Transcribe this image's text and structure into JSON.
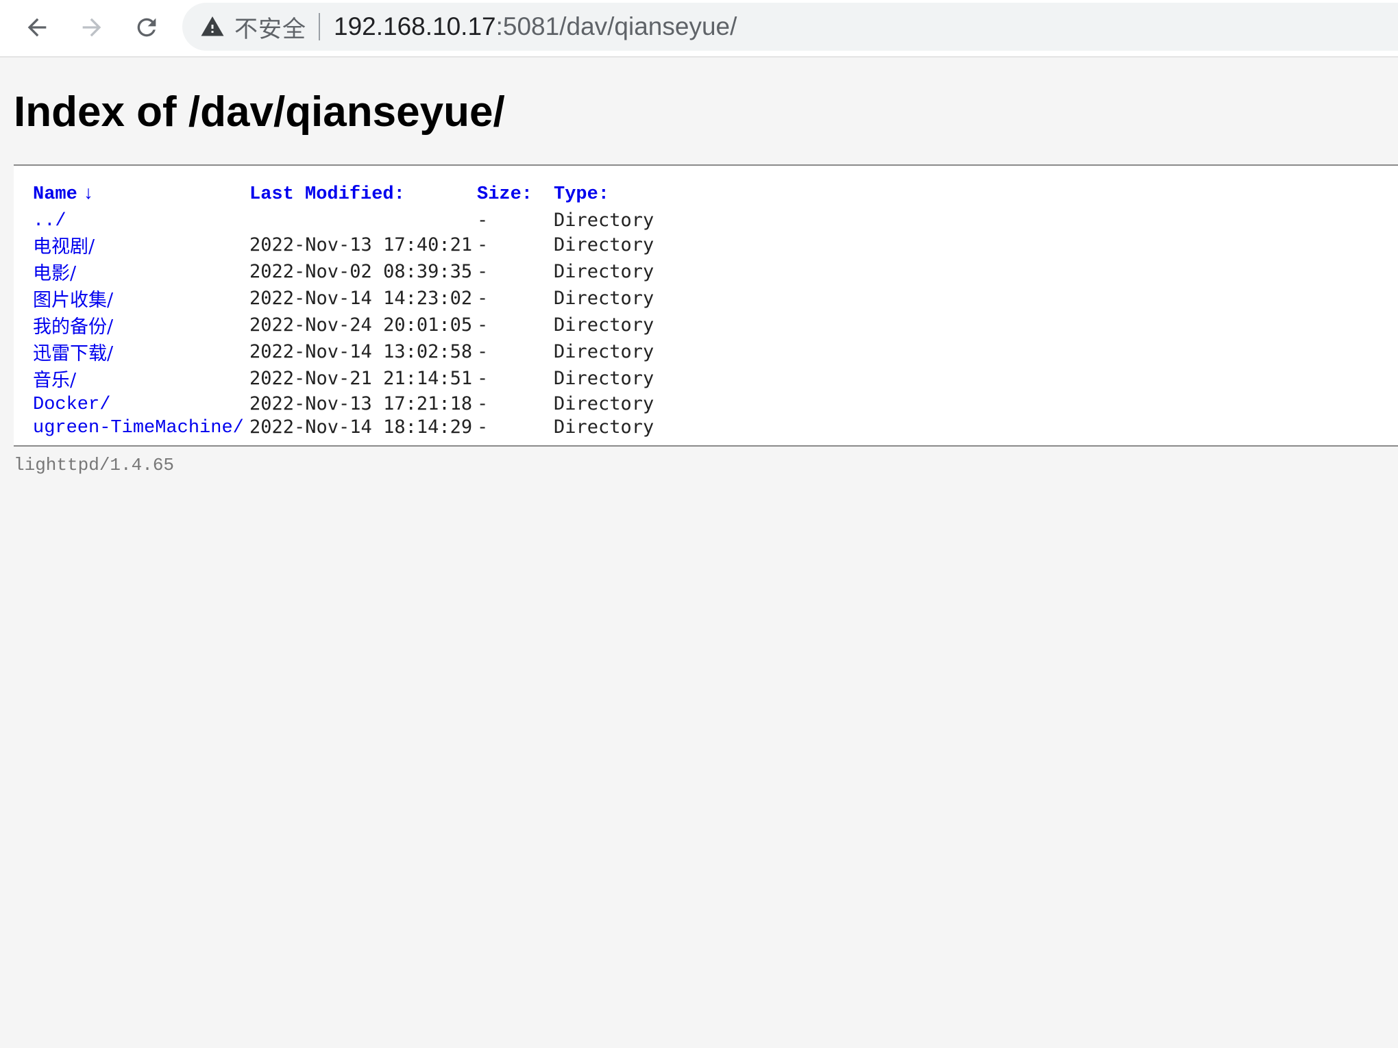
{
  "browser": {
    "security_label": "不安全",
    "url_host": "192.168.10.17",
    "url_path": ":5081/dav/qianseyue/",
    "icons": [
      "back-arrow-icon",
      "forward-arrow-icon",
      "reload-icon",
      "warning-triangle-icon"
    ]
  },
  "page": {
    "title": "Index of /dav/qianseyue/",
    "footer": "lighttpd/1.4.65"
  },
  "listing": {
    "headers": {
      "name": "Name",
      "name_sort_indicator": "↓",
      "modified": "Last Modified:",
      "size": "Size:",
      "type": "Type:"
    },
    "rows": [
      {
        "name": "../",
        "modified": "",
        "size": "-",
        "type": "Directory"
      },
      {
        "name": "电视剧/",
        "modified": "2022-Nov-13 17:40:21",
        "size": "-",
        "type": "Directory"
      },
      {
        "name": "电影/",
        "modified": "2022-Nov-02 08:39:35",
        "size": "-",
        "type": "Directory"
      },
      {
        "name": "图片收集/",
        "modified": "2022-Nov-14 14:23:02",
        "size": "-",
        "type": "Directory"
      },
      {
        "name": "我的备份/",
        "modified": "2022-Nov-24 20:01:05",
        "size": "-",
        "type": "Directory"
      },
      {
        "name": "迅雷下载/",
        "modified": "2022-Nov-14 13:02:58",
        "size": "-",
        "type": "Directory"
      },
      {
        "name": "音乐/",
        "modified": "2022-Nov-21 21:14:51",
        "size": "-",
        "type": "Directory"
      },
      {
        "name": "Docker/",
        "modified": "2022-Nov-13 17:21:18",
        "size": "-",
        "type": "Directory"
      },
      {
        "name": "ugreen-TimeMachine/",
        "modified": "2022-Nov-14 18:14:29",
        "size": "-",
        "type": "Directory"
      }
    ]
  },
  "colors": {
    "link": "#0000ee",
    "background": "#f5f5f5",
    "toolbar": "#ffffff",
    "omnibox": "#f1f3f4"
  }
}
